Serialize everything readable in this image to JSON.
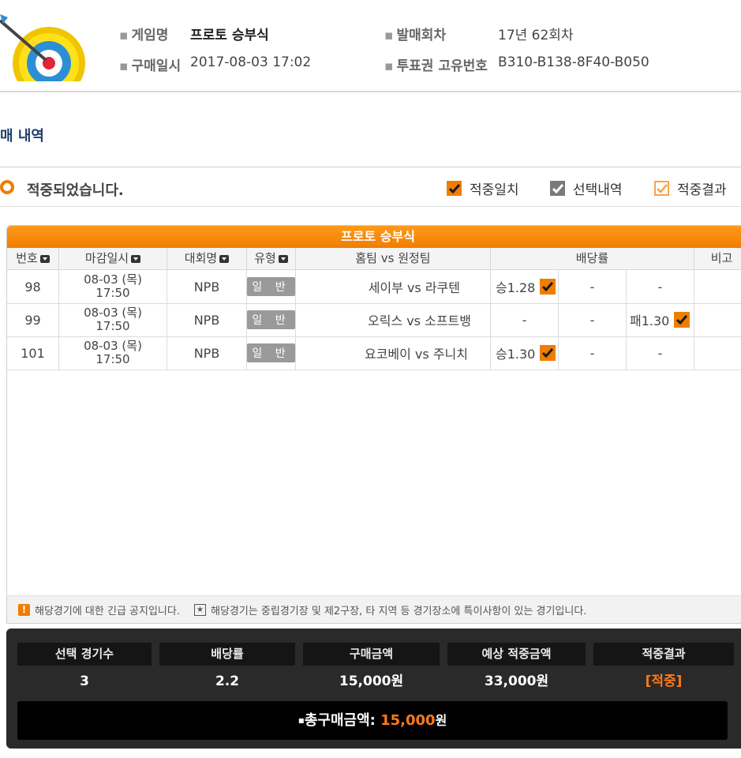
{
  "header": {
    "game_name_label": "게임명",
    "game_name_value": "프로토 승부식",
    "round_label": "발매회차",
    "round_value": "17년 62회차",
    "purchase_date_label": "구매일시",
    "purchase_date_value": "2017-08-03 17:02",
    "ticket_id_label": "투표권 고유번호",
    "ticket_id_value": "B310-B138-8F40-B050"
  },
  "section_title": "매 내역",
  "status": {
    "text": "적중되었습니다.",
    "legend": [
      {
        "label": "적중일치",
        "icon": "check-filled-orange"
      },
      {
        "label": "선택내역",
        "icon": "check-filled-gray"
      },
      {
        "label": "적중결과",
        "icon": "check-outline-orange"
      }
    ]
  },
  "table": {
    "title": "프로토 승부식",
    "columns": [
      "번호",
      "마감일시",
      "대회명",
      "유형",
      "홈팀 vs 원정팀",
      "배당률",
      "비고"
    ],
    "rows": [
      {
        "no": "98",
        "date": "08-03 (목)",
        "time": "17:50",
        "league": "NPB",
        "type": "일 반",
        "match": "세이부 vs 라쿠텐",
        "odds": [
          "승1.28",
          "-",
          "-"
        ],
        "checked": 0
      },
      {
        "no": "99",
        "date": "08-03 (목)",
        "time": "17:50",
        "league": "NPB",
        "type": "일 반",
        "match": "오릭스 vs 소프트뱅",
        "odds": [
          "-",
          "-",
          "패1.30"
        ],
        "checked": 2
      },
      {
        "no": "101",
        "date": "08-03 (목)",
        "time": "17:50",
        "league": "NPB",
        "type": "일 반",
        "match": "요코베이 vs 주니치",
        "odds": [
          "승1.30",
          "-",
          "-"
        ],
        "checked": 0
      }
    ],
    "notice_1": "해당경기에 대한 긴급 공지입니다.",
    "notice_2": "해당경기는 중립경기장 및 제2구장, 타 지역 등 경기장소에 특이사항이 있는 경기입니다."
  },
  "summary": {
    "labels": [
      "선택 경기수",
      "배당률",
      "구매금액",
      "예상 적중금액",
      "적중결과"
    ],
    "values": [
      "3",
      "2.2",
      "15,000원",
      "33,000원",
      "[적중]"
    ],
    "total_label": "총구매금액:",
    "total_amount": "15,000",
    "total_unit": "원"
  },
  "colors": {
    "accent": "#f07d00",
    "dark": "#2a2a2a",
    "title_blue": "#1d3f6e"
  }
}
